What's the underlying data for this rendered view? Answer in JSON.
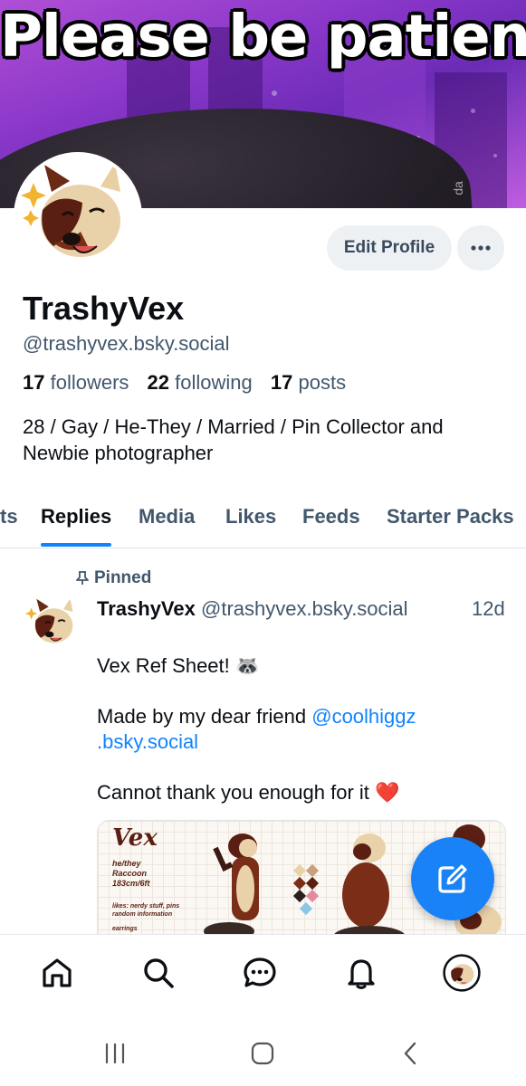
{
  "banner": {
    "caption": "Please be patient",
    "watermark": "da"
  },
  "profile": {
    "display_name": "TrashyVex",
    "handle": "@trashyvex.bsky.social",
    "followers_count": "17",
    "followers_label": "followers",
    "following_count": "22",
    "following_label": "following",
    "posts_count": "17",
    "posts_label": "posts",
    "bio_line1": "28 / Gay / He-They / Married / Pin Collector and",
    "bio_line2": "Newbie photographer"
  },
  "actions": {
    "edit_profile_label": "Edit Profile",
    "more_label": "···"
  },
  "tabs": [
    {
      "label": "ts",
      "active": false
    },
    {
      "label": "Replies",
      "active": true
    },
    {
      "label": "Media",
      "active": false
    },
    {
      "label": "Likes",
      "active": false
    },
    {
      "label": "Feeds",
      "active": false
    },
    {
      "label": "Starter Packs",
      "active": false
    }
  ],
  "post": {
    "pinned_label": "Pinned",
    "author_name": "TrashyVex",
    "author_handle": "@trashyvex.bsky.social",
    "time": "12d",
    "line1": "Vex Ref Sheet! 🦝",
    "line2_prefix": "Made by my dear friend ",
    "mention_part1": "@coolhiggz",
    "mention_part2": ".bsky.social",
    "line3": "Cannot thank you enough for it ❤️",
    "embed": {
      "title": "Vex",
      "sub_line1": "he/they",
      "sub_line2": "Raccoon",
      "sub_line3": "183cm/6ft",
      "likes_line1": "likes: nerdy stuff, pins",
      "likes_line2": "random information",
      "earrings": "earrings"
    }
  },
  "colors": {
    "accent": "#1083fe",
    "fab": "#1a82f7",
    "muted_text": "#42576c",
    "text": "#0b0f14",
    "pill_bg": "#eef1f4"
  },
  "icons": {
    "nav": [
      "home-icon",
      "search-icon",
      "chat-icon",
      "bell-icon",
      "profile-avatar"
    ],
    "system": [
      "recents-icon",
      "home-circle-icon",
      "back-icon"
    ],
    "fab": "compose-icon",
    "pin": "pin-icon"
  }
}
